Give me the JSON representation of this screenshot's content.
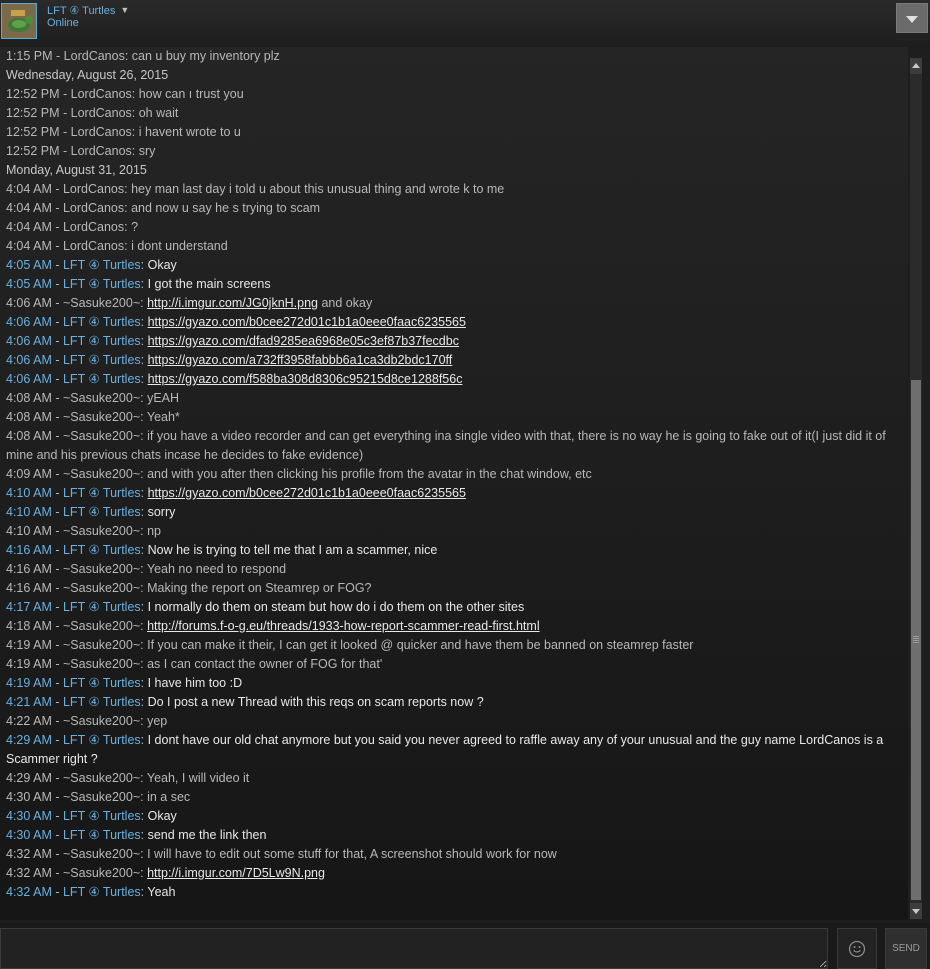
{
  "header": {
    "username": "LFT ④ Turtles",
    "status": "Online"
  },
  "messages": [
    {
      "kind": "msg",
      "who": "them",
      "time": "1:15 PM",
      "sender": "LordCanos",
      "text": "can u buy my inventory plz"
    },
    {
      "kind": "date",
      "text": "Wednesday, August 26, 2015"
    },
    {
      "kind": "msg",
      "who": "them",
      "time": "12:52 PM",
      "sender": "LordCanos",
      "text": "how can ı trust you"
    },
    {
      "kind": "msg",
      "who": "them",
      "time": "12:52 PM",
      "sender": "LordCanos",
      "text": "oh wait"
    },
    {
      "kind": "msg",
      "who": "them",
      "time": "12:52 PM",
      "sender": "LordCanos",
      "text": "i havent wrote to u"
    },
    {
      "kind": "msg",
      "who": "them",
      "time": "12:52 PM",
      "sender": "LordCanos",
      "text": "sry"
    },
    {
      "kind": "date",
      "text": "Monday, August 31, 2015"
    },
    {
      "kind": "msg",
      "who": "them",
      "time": "4:04 AM",
      "sender": "LordCanos",
      "text": "hey man last day i  told u about this unusual thing and  wrote k to me"
    },
    {
      "kind": "msg",
      "who": "them",
      "time": "4:04 AM",
      "sender": "LordCanos",
      "text": "and now u say he s trying to scam"
    },
    {
      "kind": "msg",
      "who": "them",
      "time": "4:04 AM",
      "sender": "LordCanos",
      "text": "?"
    },
    {
      "kind": "msg",
      "who": "them",
      "time": "4:04 AM",
      "sender": "LordCanos",
      "text": "i dont understand"
    },
    {
      "kind": "msg",
      "who": "me",
      "time": "4:05 AM",
      "sender": "LFT ④ Turtles",
      "text": "Okay"
    },
    {
      "kind": "msg",
      "who": "me",
      "time": "4:05 AM",
      "sender": "LFT ④ Turtles",
      "text": "I got the main screens"
    },
    {
      "kind": "msg",
      "who": "them",
      "time": "4:06 AM",
      "sender": "~Sasuke200~",
      "text": "",
      "link": "http://i.imgur.com/JG0jknH.png",
      "after": " and okay"
    },
    {
      "kind": "msg",
      "who": "me",
      "time": "4:06 AM",
      "sender": "LFT ④ Turtles",
      "text": "",
      "link": "https://gyazo.com/b0cee272d01c1b1a0eee0faac6235565"
    },
    {
      "kind": "msg",
      "who": "me",
      "time": "4:06 AM",
      "sender": "LFT ④ Turtles",
      "text": "",
      "link": "https://gyazo.com/dfad9285ea6968e05c3ef87b37fecdbc"
    },
    {
      "kind": "msg",
      "who": "me",
      "time": "4:06 AM",
      "sender": "LFT ④ Turtles",
      "text": "",
      "link": "https://gyazo.com/a732ff3958fabbb6a1ca3db2bdc170ff"
    },
    {
      "kind": "msg",
      "who": "me",
      "time": "4:06 AM",
      "sender": "LFT ④ Turtles",
      "text": "",
      "link": "https://gyazo.com/f588ba308d8306c95215d8ce1288f56c"
    },
    {
      "kind": "msg",
      "who": "them",
      "time": "4:08 AM",
      "sender": "~Sasuke200~",
      "text": "yEAH"
    },
    {
      "kind": "msg",
      "who": "them",
      "time": "4:08 AM",
      "sender": "~Sasuke200~",
      "text": "Yeah*"
    },
    {
      "kind": "msg",
      "who": "them",
      "time": "4:08 AM",
      "sender": "~Sasuke200~",
      "text": "if you have a video recorder and can get everything ina  single video with that, there is no way he is going to fake out of it(I just did it of mine and his previous chats incase he decides to fake evidence)"
    },
    {
      "kind": "msg",
      "who": "them",
      "time": "4:09 AM",
      "sender": "~Sasuke200~",
      "text": "and with you after then clicking his profile from the avatar in the chat window, etc"
    },
    {
      "kind": "msg",
      "who": "me",
      "time": "4:10 AM",
      "sender": "LFT ④ Turtles",
      "text": "",
      "link": "https://gyazo.com/b0cee272d01c1b1a0eee0faac6235565"
    },
    {
      "kind": "msg",
      "who": "me",
      "time": "4:10 AM",
      "sender": "LFT ④ Turtles",
      "text": "sorry"
    },
    {
      "kind": "msg",
      "who": "them",
      "time": "4:10 AM",
      "sender": "~Sasuke200~",
      "text": "np"
    },
    {
      "kind": "msg",
      "who": "me",
      "time": "4:16 AM",
      "sender": "LFT ④ Turtles",
      "text": "Now he is trying to tell me that I am a scammer, nice"
    },
    {
      "kind": "msg",
      "who": "them",
      "time": "4:16 AM",
      "sender": "~Sasuke200~",
      "text": "Yeah no need to respond"
    },
    {
      "kind": "msg",
      "who": "them",
      "time": "4:16 AM",
      "sender": "~Sasuke200~",
      "text": "Making the report on Steamrep or FOG?"
    },
    {
      "kind": "msg",
      "who": "me",
      "time": "4:17 AM",
      "sender": "LFT ④ Turtles",
      "text": "I normally do them on steam but how do i do them on the other sites"
    },
    {
      "kind": "msg",
      "who": "them",
      "time": "4:18 AM",
      "sender": "~Sasuke200~",
      "text": "",
      "link": "http://forums.f-o-g.eu/threads/1933-how-report-scammer-read-first.html"
    },
    {
      "kind": "msg",
      "who": "them",
      "time": "4:19 AM",
      "sender": "~Sasuke200~",
      "text": "If you can make it their, I can get it looked @ quicker and have them be banned on steamrep faster"
    },
    {
      "kind": "msg",
      "who": "them",
      "time": "4:19 AM",
      "sender": "~Sasuke200~",
      "text": "as I can contact the owner of FOG for that'"
    },
    {
      "kind": "msg",
      "who": "me",
      "time": "4:19 AM",
      "sender": "LFT ④ Turtles",
      "text": "I have him too :D"
    },
    {
      "kind": "msg",
      "who": "me",
      "time": "4:21 AM",
      "sender": "LFT ④ Turtles",
      "text": "Do I post a new Thread with this reqs on scam reports now ?"
    },
    {
      "kind": "msg",
      "who": "them",
      "time": "4:22 AM",
      "sender": "~Sasuke200~",
      "text": "yep"
    },
    {
      "kind": "msg",
      "who": "me",
      "time": "4:29 AM",
      "sender": "LFT ④ Turtles",
      "text": "I dont have our old chat anymore but you said you never agreed to raffle away any of your unusual and the guy name LordCanos is a Scammer right ?"
    },
    {
      "kind": "msg",
      "who": "them",
      "time": "4:29 AM",
      "sender": "~Sasuke200~",
      "text": "Yeah, I will video it"
    },
    {
      "kind": "msg",
      "who": "them",
      "time": "4:30 AM",
      "sender": "~Sasuke200~",
      "text": "in a sec"
    },
    {
      "kind": "msg",
      "who": "me",
      "time": "4:30 AM",
      "sender": "LFT ④ Turtles",
      "text": "Okay"
    },
    {
      "kind": "msg",
      "who": "me",
      "time": "4:30 AM",
      "sender": "LFT ④ Turtles",
      "text": "send me the link then"
    },
    {
      "kind": "msg",
      "who": "them",
      "time": "4:32 AM",
      "sender": "~Sasuke200~",
      "text": "I will have to edit out some stuff for that, A screenshot should work for now"
    },
    {
      "kind": "msg",
      "who": "them",
      "time": "4:32 AM",
      "sender": "~Sasuke200~",
      "text": "",
      "link": "http://i.imgur.com/7D5Lw9N.png"
    },
    {
      "kind": "msg",
      "who": "me",
      "time": "4:32 AM",
      "sender": "LFT ④ Turtles",
      "text": "Yeah"
    }
  ],
  "composer": {
    "value": "",
    "send_label": "SEND"
  },
  "icons": {
    "menu": "dropdown-triangle-icon",
    "emoticon": "smiley-icon",
    "scroll_up": "arrow-up-icon",
    "scroll_down": "arrow-down-icon"
  },
  "colors": {
    "self": "#6ab0e0",
    "other": "#b8b8b8",
    "background": "#1e1e1e"
  }
}
